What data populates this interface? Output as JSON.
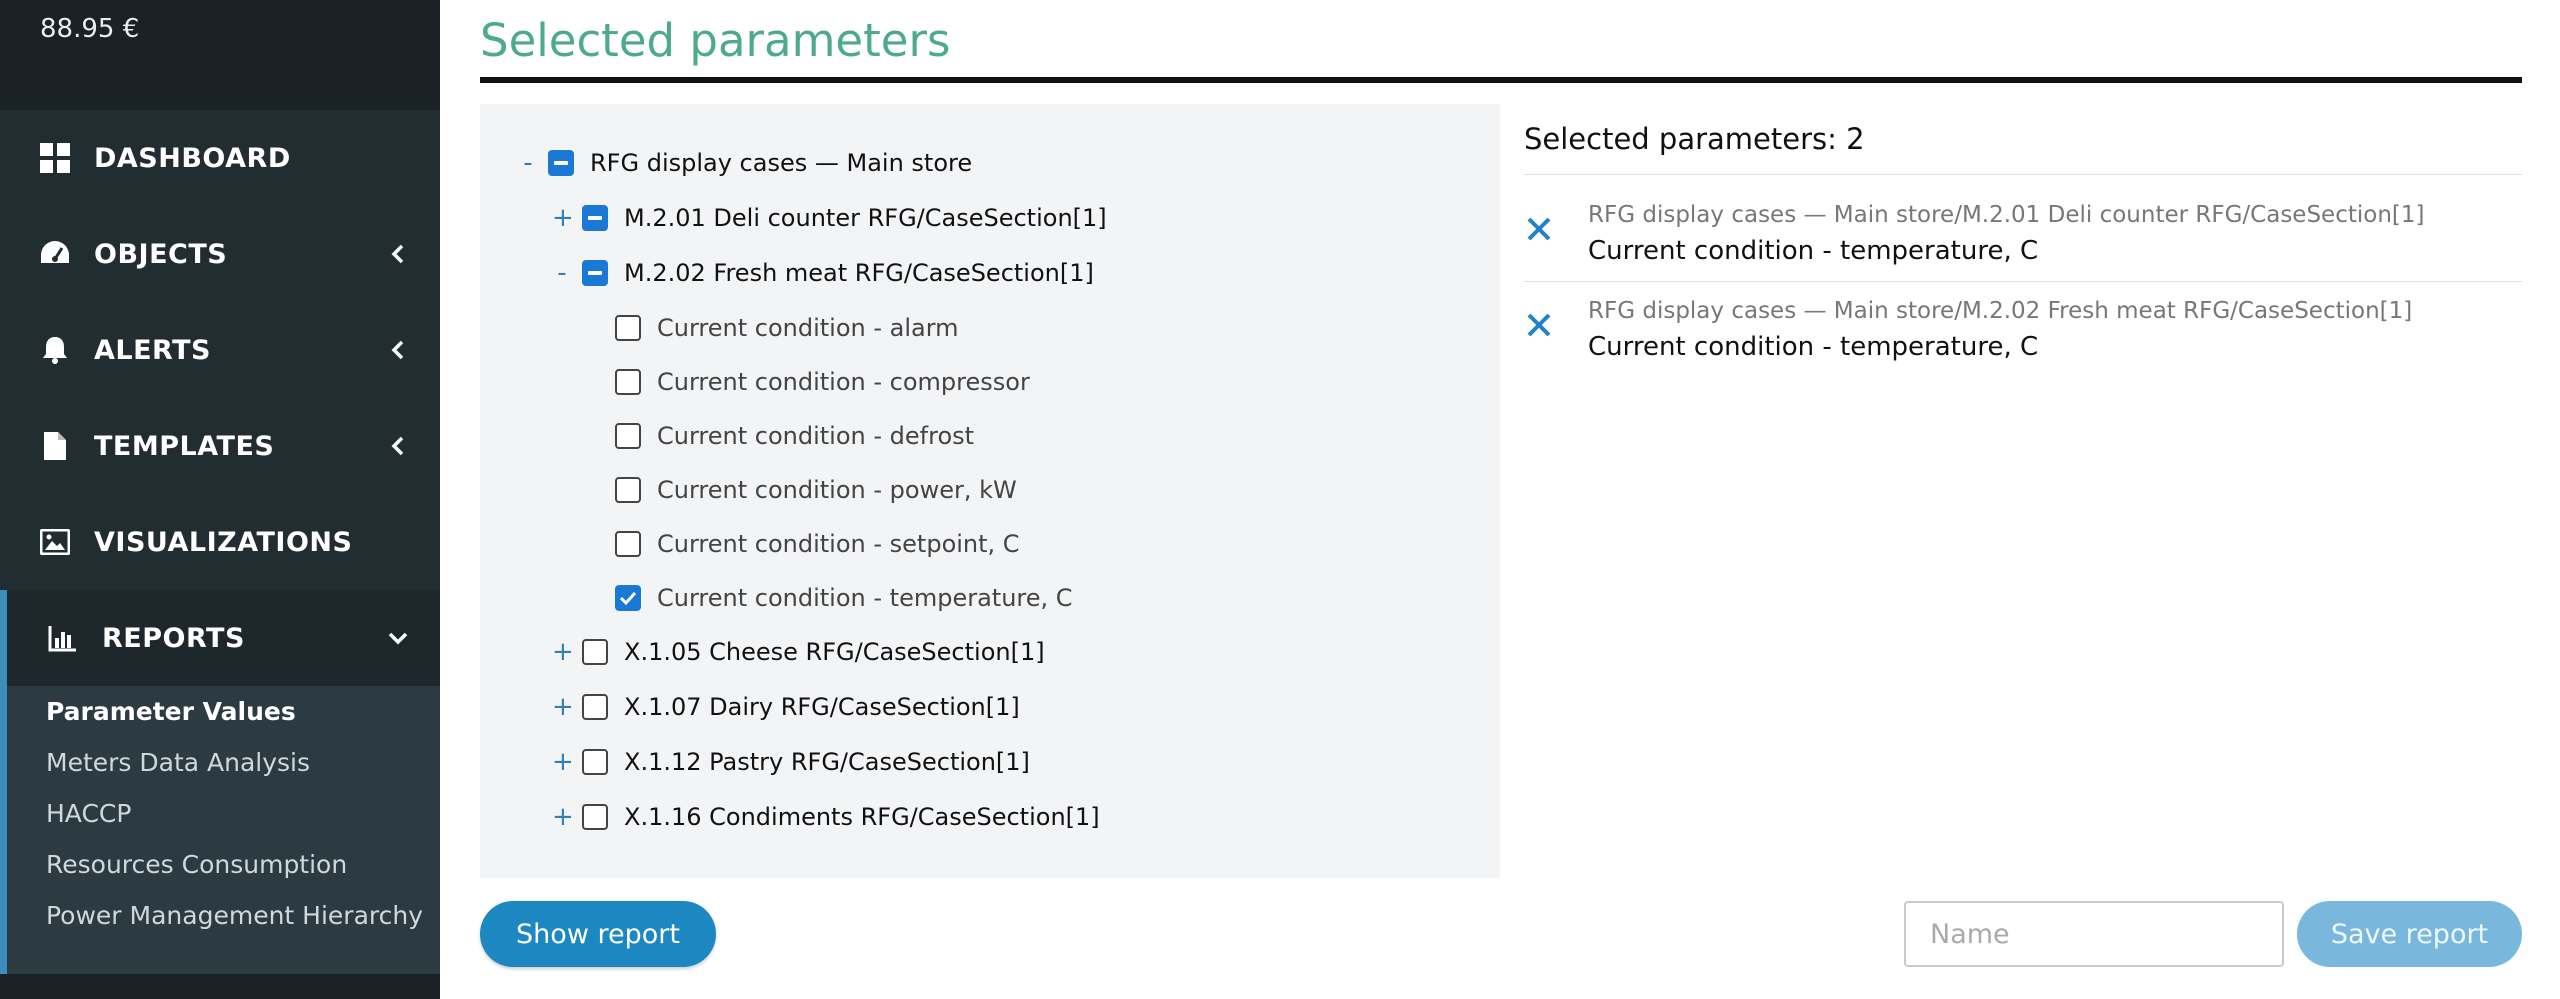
{
  "sidebar": {
    "balance": "88.95 €",
    "nav": [
      {
        "label": "DASHBOARD",
        "icon": "dashboard-icon"
      },
      {
        "label": "OBJECTS",
        "icon": "gauge-icon"
      },
      {
        "label": "ALERTS",
        "icon": "bell-icon"
      },
      {
        "label": "TEMPLATES",
        "icon": "file-icon"
      },
      {
        "label": "VISUALIZATIONS",
        "icon": "image-icon"
      },
      {
        "label": "REPORTS",
        "icon": "bar-chart-icon"
      }
    ],
    "reports_submenu": [
      "Parameter Values",
      "Meters Data Analysis",
      "HACCP",
      "Resources Consumption",
      "Power Management Hierarchy"
    ],
    "active_submenu_item": "Parameter Values"
  },
  "page": {
    "title": "Selected parameters"
  },
  "tree": {
    "root": {
      "toggle": "-",
      "label": "RFG display cases — Main store",
      "state": "partial"
    },
    "cases": [
      {
        "toggle": "+",
        "label": "M.2.01 Deli counter RFG/CaseSection[1]",
        "state": "partial"
      },
      {
        "toggle": "-",
        "label": "M.2.02 Fresh meat RFG/CaseSection[1]",
        "state": "partial"
      }
    ],
    "params": [
      {
        "label": "Current condition - alarm",
        "checked": false
      },
      {
        "label": "Current condition - compressor",
        "checked": false
      },
      {
        "label": "Current condition - defrost",
        "checked": false
      },
      {
        "label": "Current condition - power, kW",
        "checked": false
      },
      {
        "label": "Current condition - setpoint, C",
        "checked": false
      },
      {
        "label": "Current condition - temperature, C",
        "checked": true
      }
    ],
    "other_cases": [
      {
        "toggle": "+",
        "label": "X.1.05 Cheese RFG/CaseSection[1]",
        "state": "unchecked"
      },
      {
        "toggle": "+",
        "label": "X.1.07 Dairy RFG/CaseSection[1]",
        "state": "unchecked"
      },
      {
        "toggle": "+",
        "label": "X.1.12 Pastry RFG/CaseSection[1]",
        "state": "unchecked"
      },
      {
        "toggle": "+",
        "label": "X.1.16 Condiments RFG/CaseSection[1]",
        "state": "unchecked"
      }
    ]
  },
  "selected": {
    "count_label": "Selected parameters: 2",
    "items": [
      {
        "path": "RFG display cases — Main store/M.2.01 Deli counter RFG/CaseSection[1]",
        "name": "Current condition - temperature, C"
      },
      {
        "path": "RFG display cases — Main store/M.2.02 Fresh meat RFG/CaseSection[1]",
        "name": "Current condition - temperature, C"
      }
    ]
  },
  "actions": {
    "show_report": "Show report",
    "name_placeholder": "Name",
    "name_value": "",
    "save_report": "Save report"
  },
  "colors": {
    "sidebar_bg": "#222d32",
    "accent": "#3c8dbc",
    "title": "#4eaa8c",
    "checkbox": "#1a78d6",
    "button_primary": "#1d87c2",
    "button_disabled": "#79b8dc"
  }
}
